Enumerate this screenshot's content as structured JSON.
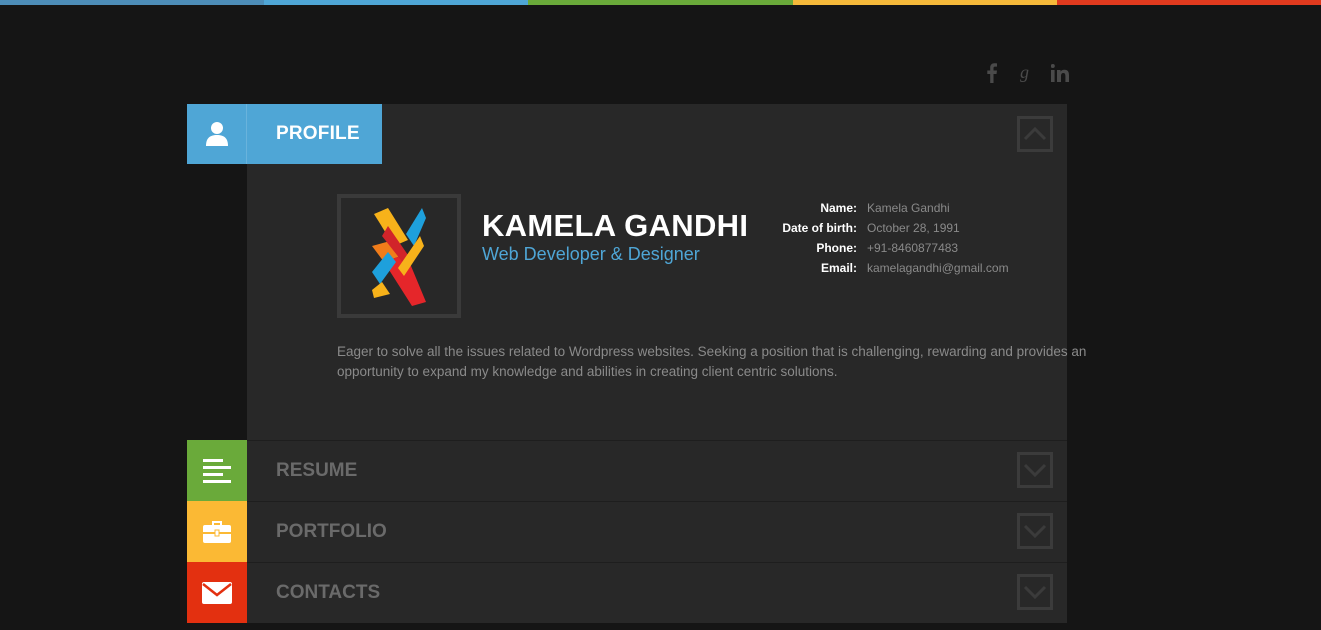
{
  "colors": {
    "bar": [
      "#4fa6d6",
      "#4fa6d6",
      "#6aaa3a",
      "#f5b93a",
      "#e03a1e"
    ],
    "profile": "#4fa6d6",
    "resume": "#6aaa3a",
    "portfolio": "#fbb934",
    "contacts": "#e33010"
  },
  "social": [
    "facebook-icon",
    "google-plus-icon",
    "linkedin-icon"
  ],
  "profile": {
    "tab_label": "PROFILE",
    "name": "KAMELA GANDHI",
    "role": "Web Developer & Designer",
    "info": [
      {
        "label": "Name:",
        "value": "Kamela Gandhi"
      },
      {
        "label": "Date of birth:",
        "value": "October 28, 1991"
      },
      {
        "label": "Phone:",
        "value": "+91-8460877483"
      },
      {
        "label": "Email:",
        "value": "kamelagandhi@gmail.com"
      }
    ],
    "summary": "Eager to solve all the issues related to Wordpress websites. Seeking a position that is challenging, rewarding and provides an opportunity to expand my knowledge and abilities in creating client centric solutions."
  },
  "sections": [
    {
      "label": "RESUME",
      "icon": "resume-icon"
    },
    {
      "label": "PORTFOLIO",
      "icon": "briefcase-icon"
    },
    {
      "label": "CONTACTS",
      "icon": "envelope-icon"
    }
  ]
}
